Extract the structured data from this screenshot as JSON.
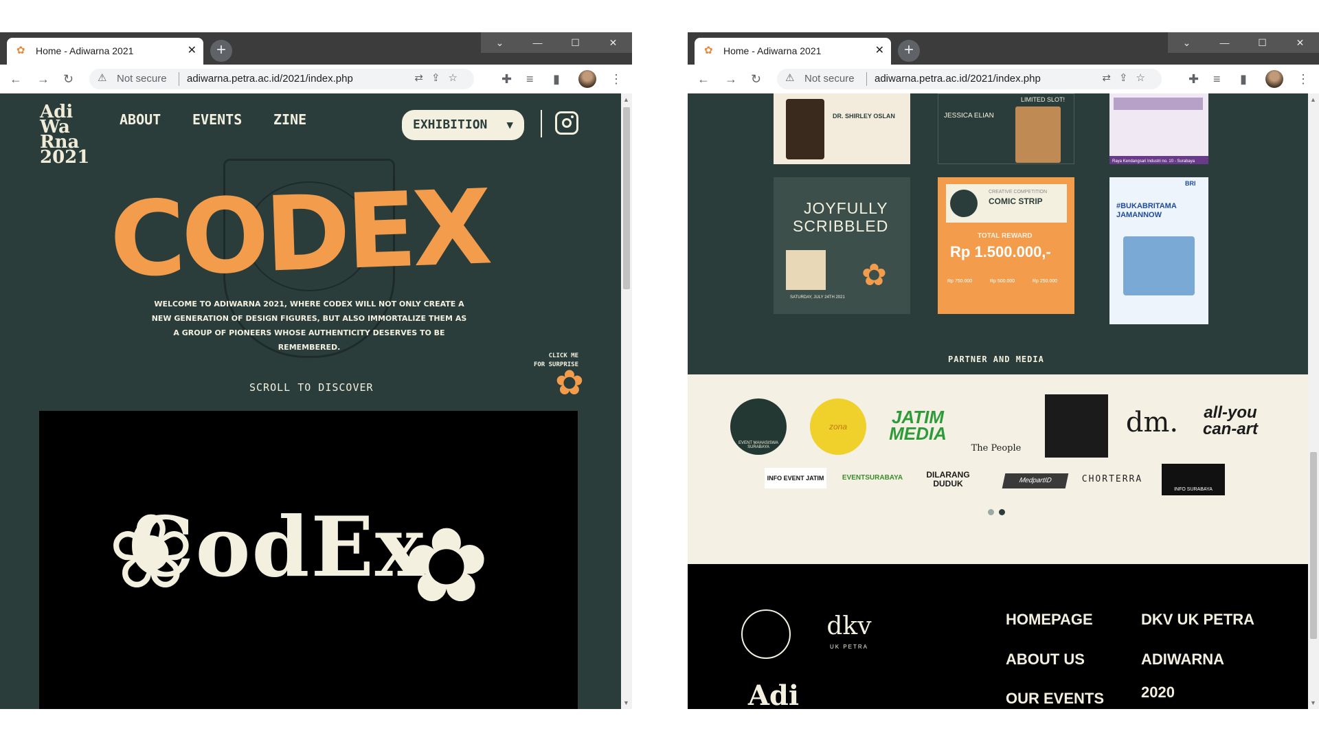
{
  "browser": {
    "tab_title": "Home - Adiwarna 2021",
    "not_secure": "Not secure",
    "url": "adiwarna.petra.ac.id/2021/index.php"
  },
  "left_page": {
    "logo": "Adi Wa Rna 2021",
    "nav": [
      "ABOUT",
      "EVENTS",
      "ZINE"
    ],
    "exhibition_label": "EXHIBITION",
    "hero_title": "CODEX",
    "welcome_text": "WELCOME TO ADIWARNA 2021, WHERE CODEX WILL NOT ONLY CREATE A NEW GENERATION OF DESIGN FIGURES, BUT ALSO IMMORTALIZE THEM AS A GROUP OF PIONEERS WHOSE AUTHENTICITY DESERVES TO BE REMEMBERED.",
    "surprise_line1": "CLICK ME",
    "surprise_line2": "FOR SURPRISE",
    "scroll_label": "SCROLL TO DISCOVER",
    "video_text": "CodEx"
  },
  "right_page": {
    "posters_top": [
      {
        "text": "DR. SHIRLEY OSLAN"
      },
      {
        "text": "JESSICA ELIAN",
        "badge": "LIMITED SLOT!"
      },
      {
        "text": "Raya Kendangsari Industri no. 10 - Surabaya"
      }
    ],
    "poster_joyfully": {
      "line1": "JOYFULLY",
      "line2": "SCRIBBLED",
      "date": "SATURDAY, JULY 24TH 2021"
    },
    "poster_comic": {
      "kicker": "CREATIVE COMPETITION",
      "title": "COMIC STRIP",
      "reward_label": "TOTAL REWARD",
      "reward_value": "Rp 1.500.000,-",
      "prizes": [
        "Rp 750.000",
        "Rp 500.000",
        "Rp 250.000"
      ]
    },
    "poster_bri": {
      "brand": "BRI",
      "headline": "#BUKABRITAMA JAMANNOW"
    },
    "partner_title": "PARTNER AND MEDIA",
    "partners_row1": [
      "EVENT MAHASISWA SURABAYA",
      "zona",
      "JATIM MEDIA",
      "The People",
      "",
      "dm.",
      "all-you can-art"
    ],
    "partners_row2": [
      "INFO EVENT JATIM",
      "EVENTSURABAYA",
      "DILARANG DUDUK",
      "MedpartID",
      "CHORTERRA",
      "INFO SURABAYA"
    ],
    "footer": {
      "col1": [
        "HOMEPAGE",
        "ABOUT US",
        "OUR EVENTS"
      ],
      "col2": [
        "DKV UK PETRA",
        "ADIWARNA",
        "2020"
      ],
      "dkv_logo": "dkv",
      "dkv_sub": "UK PETRA",
      "adi_logo": "Adi"
    }
  },
  "colors": {
    "page_bg": "#2b3d3b",
    "accent": "#f39c4c",
    "cream": "#f3f0df"
  }
}
